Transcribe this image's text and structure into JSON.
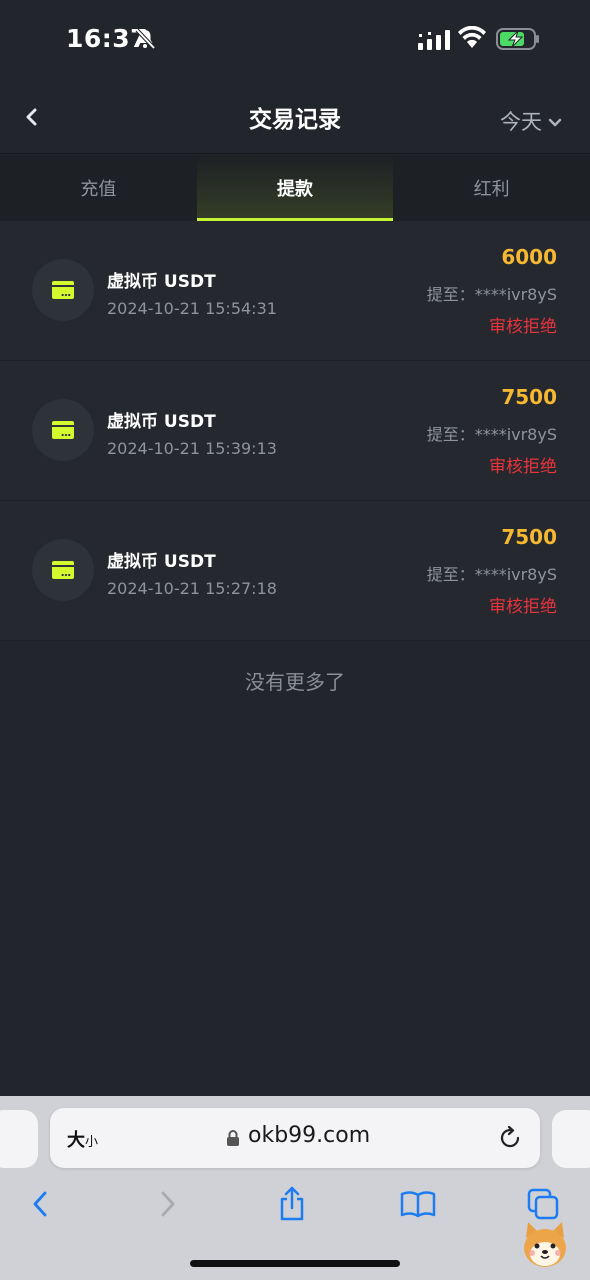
{
  "status_bar": {
    "time": "16:37"
  },
  "header": {
    "title": "交易记录",
    "date_filter": "今天"
  },
  "tabs": [
    {
      "label": "充值",
      "active": false
    },
    {
      "label": "提款",
      "active": true
    },
    {
      "label": "红利",
      "active": false
    }
  ],
  "records": [
    {
      "title": "虚拟币 USDT",
      "time": "2024-10-21 15:54:31",
      "amount": "6000",
      "dest": "提至：****ivr8yS",
      "status": "审核拒绝"
    },
    {
      "title": "虚拟币 USDT",
      "time": "2024-10-21 15:39:13",
      "amount": "7500",
      "dest": "提至：****ivr8yS",
      "status": "审核拒绝"
    },
    {
      "title": "虚拟币 USDT",
      "time": "2024-10-21 15:27:18",
      "amount": "7500",
      "dest": "提至：****ivr8yS",
      "status": "审核拒绝"
    }
  ],
  "footer_text": "没有更多了",
  "browser": {
    "text_size_big": "大",
    "text_size_small": "小",
    "url": "okb99.com"
  },
  "colors": {
    "accent": "#c6f534",
    "amount": "#f5b830",
    "rejected": "#e8333b",
    "background": "#22252b"
  },
  "icons": {
    "back": "chevron-left-icon",
    "date_dropdown": "chevron-down-icon",
    "record": "card-icon",
    "lock": "lock-icon",
    "reload": "reload-icon"
  }
}
